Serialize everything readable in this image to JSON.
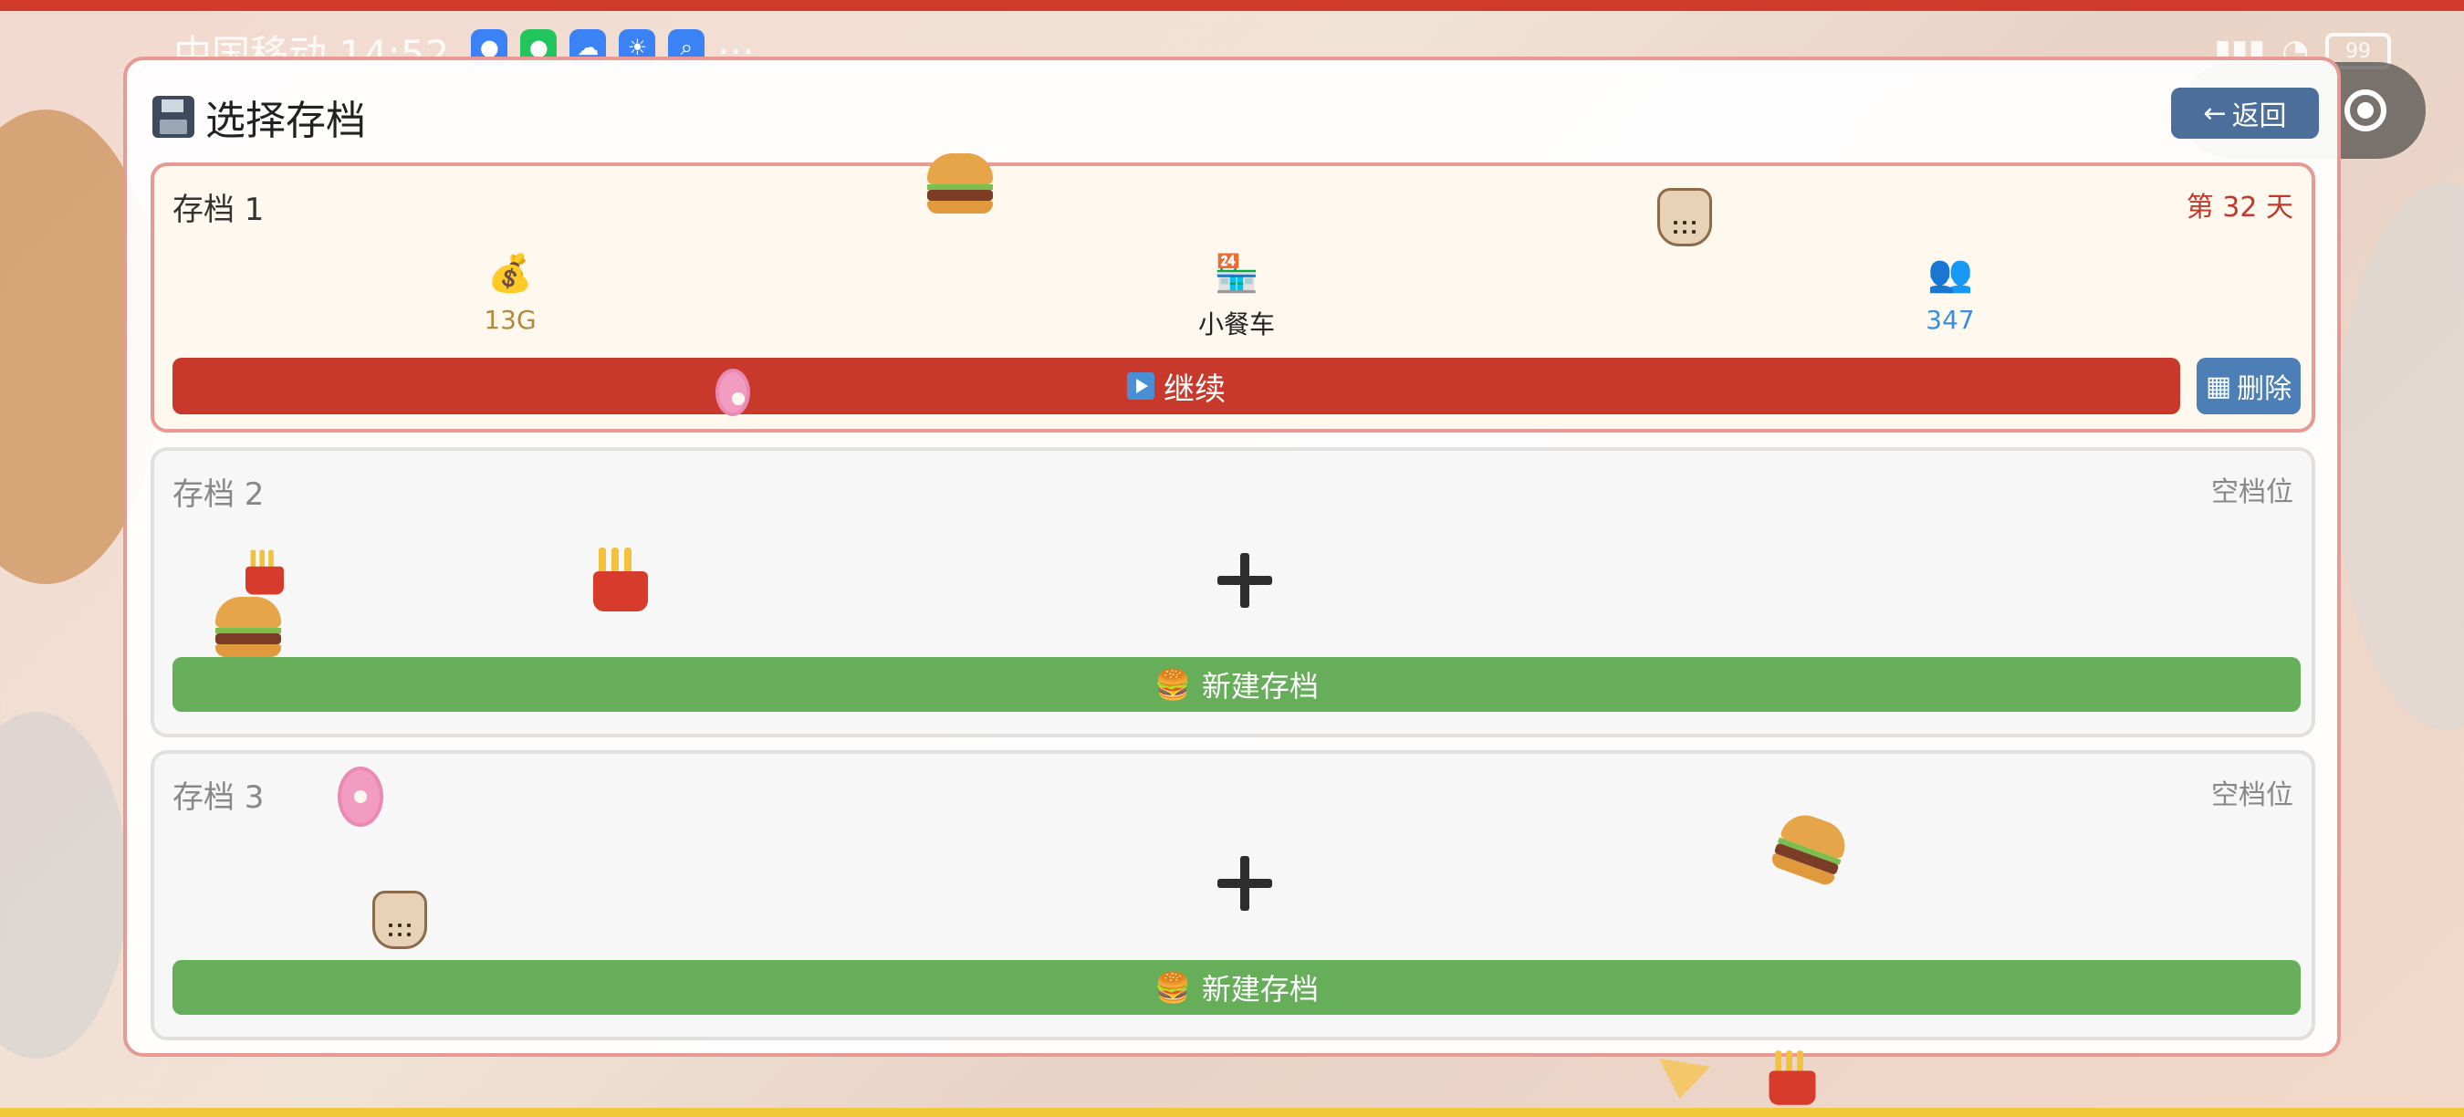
{
  "status_bar": {
    "carrier_time": "中国移动 14:52",
    "battery": "99"
  },
  "panel": {
    "title": "选择存档",
    "back_label": "返回"
  },
  "slots": [
    {
      "name": "存档 1",
      "tag": "第 32 天",
      "stats": {
        "money": "13G",
        "vehicle": "小餐车",
        "fans": "347"
      },
      "continue_label": "继续",
      "delete_label": "删除"
    },
    {
      "name": "存档 2",
      "tag": "空档位",
      "new_label": "新建存档"
    },
    {
      "name": "存档 3",
      "tag": "空档位",
      "new_label": "新建存档"
    }
  ],
  "colors": {
    "continue": "#c9392b",
    "delete": "#4b7fb6",
    "new": "#67ae5a",
    "day_text": "#c0392b",
    "fans_text": "#3a8ee0",
    "money_text": "#b08a3e"
  },
  "icons": {
    "title": "floppy-disk-icon",
    "money": "money-bag-icon",
    "vehicle": "convenience-store-icon",
    "fans": "people-icon",
    "continue": "play-icon",
    "delete": "trash-icon",
    "new": "burger-icon"
  }
}
